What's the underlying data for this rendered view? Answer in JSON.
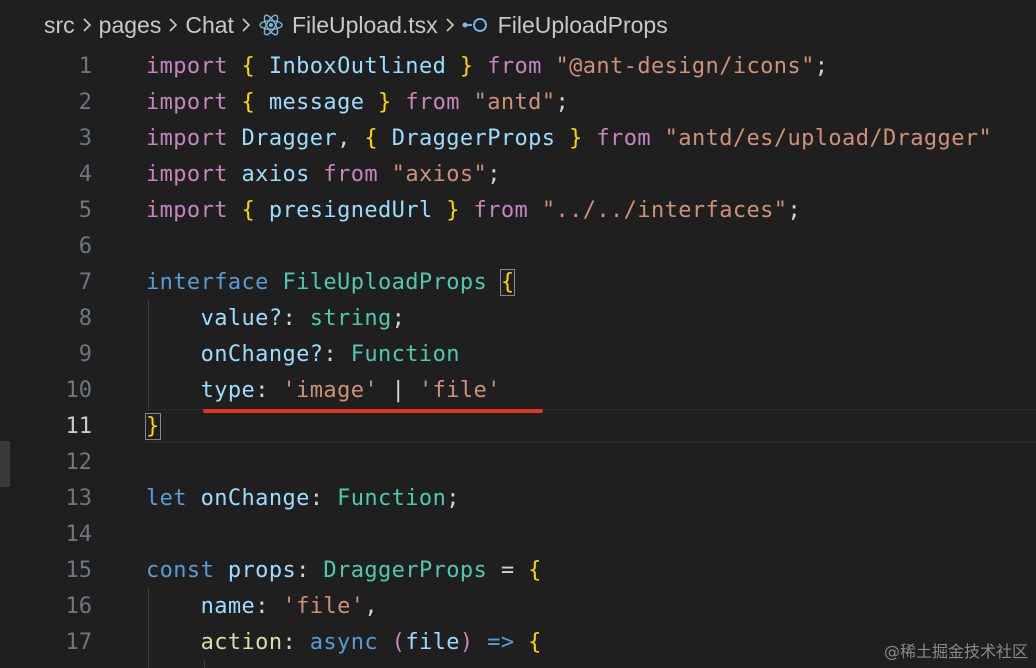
{
  "breadcrumb": {
    "items": [
      "src",
      "pages",
      "Chat",
      "FileUpload.tsx",
      "FileUploadProps"
    ],
    "icons": [
      "chevron-right-icon",
      "react-icon",
      "interface-icon"
    ]
  },
  "editor": {
    "current_line": 11,
    "lines": [
      {
        "n": "1"
      },
      {
        "n": "2"
      },
      {
        "n": "3"
      },
      {
        "n": "4"
      },
      {
        "n": "5"
      },
      {
        "n": "6"
      },
      {
        "n": "7"
      },
      {
        "n": "8"
      },
      {
        "n": "9"
      },
      {
        "n": "10"
      },
      {
        "n": "11"
      },
      {
        "n": "12"
      },
      {
        "n": "13"
      },
      {
        "n": "14"
      },
      {
        "n": "15"
      },
      {
        "n": "16"
      },
      {
        "n": "17"
      }
    ],
    "tokens": {
      "import": "import",
      "from": "from",
      "interface": "interface",
      "let": "let",
      "const": "const",
      "async": "async",
      "l1_inbox": "InboxOutlined",
      "l1_src": "\"@ant-design/icons\"",
      "l2_message": "message",
      "l2_src": "\"antd\"",
      "l3_dragger": "Dragger",
      "l3_draggerprops": "DraggerProps",
      "l3_src": "\"antd/es/upload/Dragger\"",
      "l4_axios": "axios",
      "l4_src": "\"axios\"",
      "l5_presigned": "presignedUrl",
      "l5_src": "\"../../interfaces\"",
      "l7_name": "FileUploadProps",
      "l8_prop": "value?",
      "l8_type": "string",
      "l9_prop": "onChange?",
      "l9_type": "Function",
      "l10_prop": "type",
      "l10_v1": "'image'",
      "l10_v2": "'file'",
      "l13_var": "onChange",
      "l13_type": "Function",
      "l15_var": "props",
      "l15_type": "DraggerProps",
      "l16_prop": "name",
      "l16_val": "'file'",
      "l17_prop": "action",
      "l17_arg": "file"
    }
  },
  "watermark": "@稀土掘金技术社区",
  "colors": {
    "background": "#1f1f1f",
    "keyword": "#c586c0",
    "declaration": "#569cd6",
    "bracket": "#ffd700",
    "identifier": "#9cdcfe",
    "string": "#ce9178",
    "type": "#4ec9b0",
    "annotation_underline": "#e0341f"
  }
}
